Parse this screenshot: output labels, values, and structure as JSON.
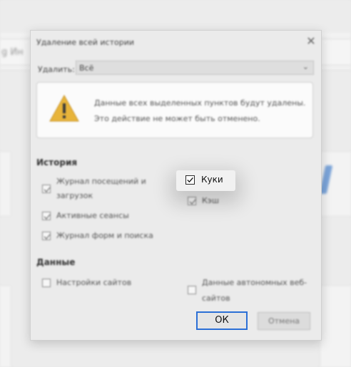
{
  "browser": {
    "url_fragment": "g Ин"
  },
  "dialog": {
    "title": "Удаление всей истории",
    "close_glyph": "✕",
    "range": {
      "label": "Удалить:",
      "value": "Всё"
    },
    "warning": {
      "line1": "Данные всех выделенных пунктов будут удалены.",
      "line2": "Это действие не может быть отменено."
    },
    "history": {
      "title": "История",
      "items": [
        {
          "label_line1": "Журнал посещений и",
          "label_line2": "загрузок",
          "checked": true
        },
        {
          "label": "Активные сеансы",
          "checked": true
        },
        {
          "label": "Журнал форм и поиска",
          "checked": true
        }
      ],
      "right_items": [
        {
          "label": "Куки",
          "checked": true
        },
        {
          "label": "Кэш",
          "checked": true
        }
      ]
    },
    "data": {
      "title": "Данные",
      "items": [
        {
          "label": "Настройки сайтов",
          "checked": false
        },
        {
          "label_line1": "Данные автономных веб-",
          "label_line2": "сайтов",
          "checked": false
        }
      ]
    },
    "buttons": {
      "ok": "ОК",
      "cancel": "Отмена"
    }
  },
  "focused_option": {
    "label": "Куки",
    "checked": true,
    "icon": "checkbox-checked-icon"
  },
  "colors": {
    "accent": "#2b6fd6",
    "warning_yellow": "#e8b43a"
  }
}
